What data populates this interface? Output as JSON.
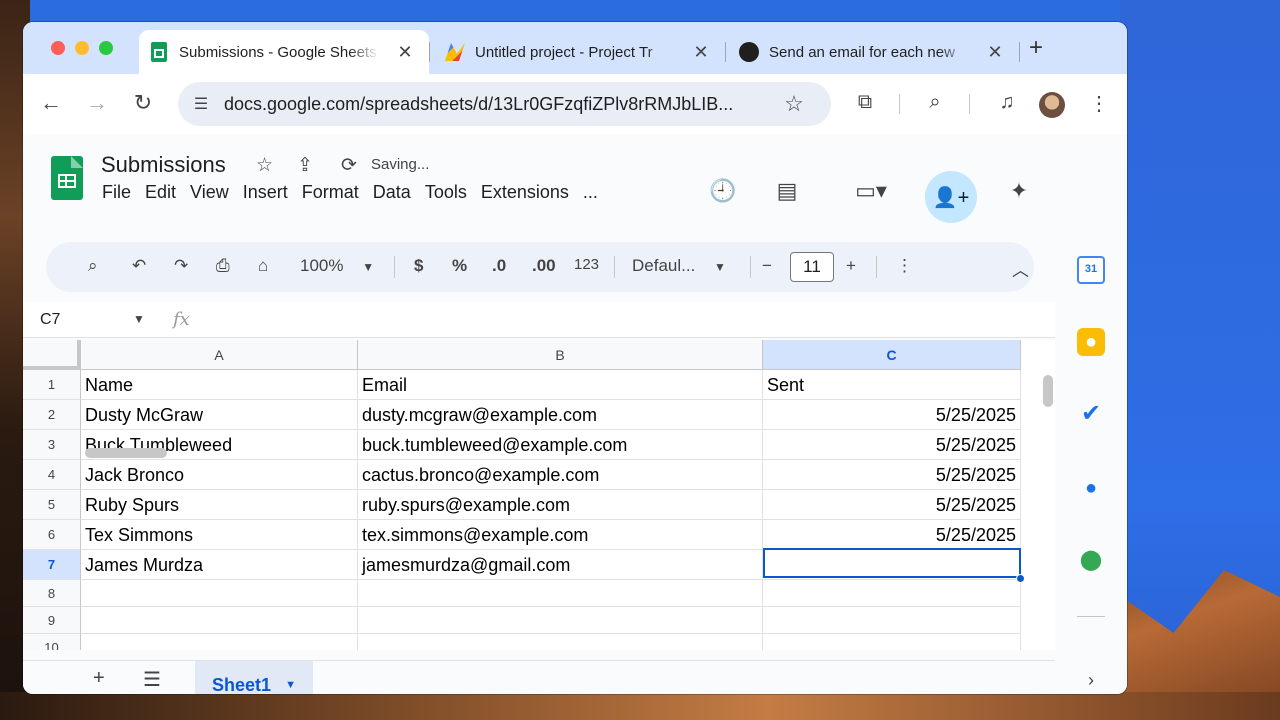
{
  "browser": {
    "tabs": [
      {
        "title": "Submissions - Google Sheets",
        "favicon": "sheets-icon",
        "active": true
      },
      {
        "title": "Untitled project - Project Tr",
        "favicon": "apps-script-icon",
        "active": false
      },
      {
        "title": "Send an email for each new",
        "favicon": "github-icon",
        "active": false
      }
    ],
    "url": "docs.google.com/spreadsheets/d/13Lr0GFzqfiZPlv8rRMJbLIB..."
  },
  "doc": {
    "title": "Submissions",
    "status": "Saving...",
    "menu": [
      "File",
      "Edit",
      "View",
      "Insert",
      "Format",
      "Data",
      "Tools",
      "Extensions",
      "..."
    ]
  },
  "format_bar": {
    "zoom": "100%",
    "currency": "$",
    "percent": "%",
    "dec_decrease": ".0",
    "dec_increase": ".00",
    "number_format": "123",
    "font": "Defaul...",
    "font_size": "11"
  },
  "formula_bar": {
    "name_box": "C7",
    "fx": "fx",
    "value": ""
  },
  "sheet": {
    "columns": [
      "A",
      "B",
      "C"
    ],
    "selected_column": "C",
    "selected_row": "7",
    "row_numbers": [
      "1",
      "2",
      "3",
      "4",
      "5",
      "6",
      "7",
      "8",
      "9",
      "10"
    ],
    "rows": [
      [
        "Name",
        "Email",
        "Sent"
      ],
      [
        "Dusty McGraw",
        "dusty.mcgraw@example.com",
        "5/25/2025"
      ],
      [
        "Buck Tumbleweed",
        "buck.tumbleweed@example.com",
        "5/25/2025"
      ],
      [
        "Jack Bronco",
        "cactus.bronco@example.com",
        "5/25/2025"
      ],
      [
        "Ruby Spurs",
        "ruby.spurs@example.com",
        "5/25/2025"
      ],
      [
        "Tex Simmons",
        "tex.simmons@example.com",
        "5/25/2025"
      ],
      [
        "James Murdza",
        "jamesmurdza@gmail.com",
        ""
      ],
      [
        "",
        "",
        ""
      ],
      [
        "",
        "",
        ""
      ],
      [
        "",
        "",
        ""
      ]
    ]
  },
  "sheet_tabs": [
    {
      "name": "Sheet1",
      "active": true
    }
  ],
  "side_panel": [
    "calendar-icon",
    "keep-icon",
    "tasks-icon",
    "contacts-icon",
    "maps-icon"
  ],
  "colors": {
    "accent": "#0b57d0",
    "sheets_green": "#0f9d58",
    "tabbar": "#d3e3fd",
    "selected_header": "#d3e3fd"
  }
}
